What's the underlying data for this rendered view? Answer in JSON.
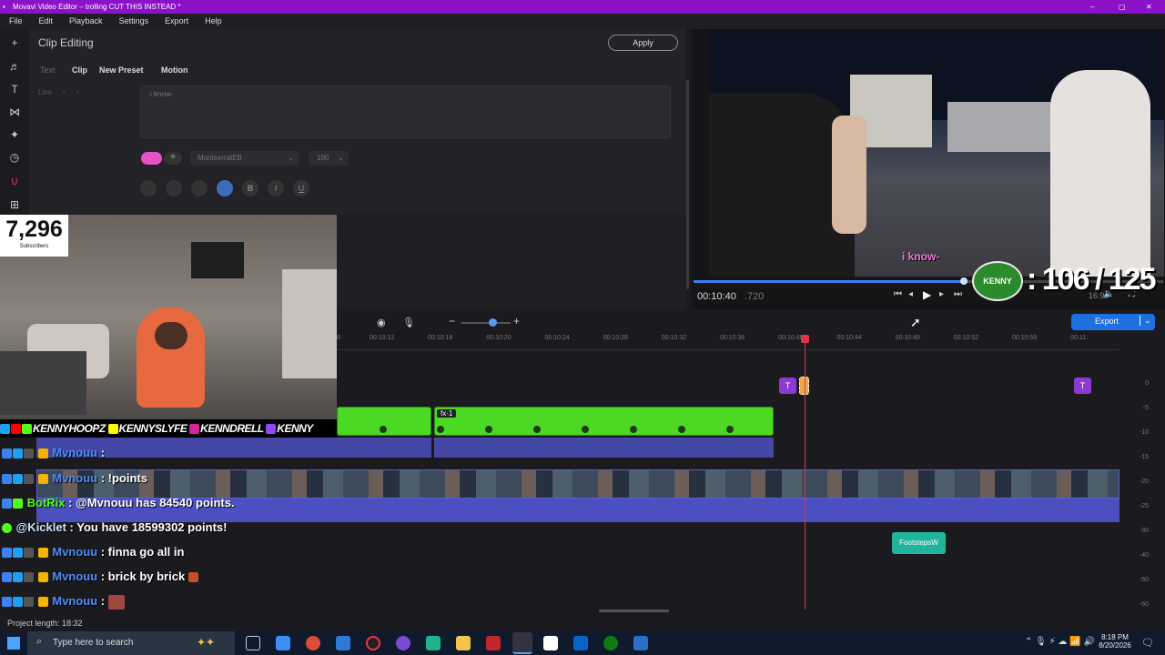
{
  "window": {
    "title": "Movavi Video Editor – trolling CUT THIS INSTEAD *",
    "controls": [
      "–",
      "▢",
      "✕"
    ]
  },
  "menu": [
    "File",
    "Edit",
    "Playback",
    "Settings",
    "Export",
    "Help"
  ],
  "clip_editing": {
    "title": "Clip Editing",
    "apply_label": "Apply",
    "tabs": [
      "Text",
      "Clip",
      "New Preset",
      "Motion"
    ],
    "line_label": "Line",
    "text_value": "i know-",
    "font": "MontserratEB",
    "size": "100"
  },
  "preview": {
    "caption": "i know-",
    "time": "00:10:40",
    "frames": ".720",
    "aspect": "16:9",
    "progress": 0.93
  },
  "overlay": {
    "subscribers_count": "7,296",
    "subscribers_label": "Subscribers",
    "goal": ": 106 / 125",
    "badge_text": "KENNY",
    "socials": [
      "KENNYHOOPZ",
      "KENNYSLYFE",
      "KENNDRELL",
      "KENNY"
    ]
  },
  "timeline": {
    "export_label": "Export",
    "ticks": [
      "8",
      "00:10:12",
      "00:10:16",
      "00:10:20",
      "00:10:24",
      "00:10:28",
      "00:10:32",
      "00:10:36",
      "00:10:40",
      "00:10:44",
      "00:10:48",
      "00:10:52",
      "00:10:56",
      "00:11:"
    ],
    "db_scale": [
      "0",
      "-5",
      "-10",
      "-15",
      "-20",
      "-25",
      "-30",
      "-40",
      "-50",
      "-60"
    ],
    "fx_label": "fx·1",
    "audio_clip": "FootstepsW",
    "title_clip": "T"
  },
  "chat": [
    {
      "user": "Mvnouu",
      "msg": " :"
    },
    {
      "user": "Mvnouu",
      "msg": " : !points"
    },
    {
      "user": "BotRix",
      "msg": " : @Mvnouu has 84540 points."
    },
    {
      "user": "@Kicklet",
      "msg": " : You have 18599302 points!"
    },
    {
      "user": "Mvnouu",
      "msg": " : finna go all in"
    },
    {
      "user": "Mvnouu",
      "msg": " : brick by brick"
    },
    {
      "user": "Mvnouu",
      "msg": " :"
    }
  ],
  "status": {
    "project_length": "Project length: 18:32"
  },
  "taskbar": {
    "search_placeholder": "Type here to search",
    "time": "8:18 PM",
    "date": "8/20/2026"
  },
  "colors": {
    "accent": "#8b12c8",
    "green_clip": "#4bd924",
    "audio": "#4c4fc0",
    "playhead": "#e0344a",
    "export": "#1e6fe0"
  }
}
